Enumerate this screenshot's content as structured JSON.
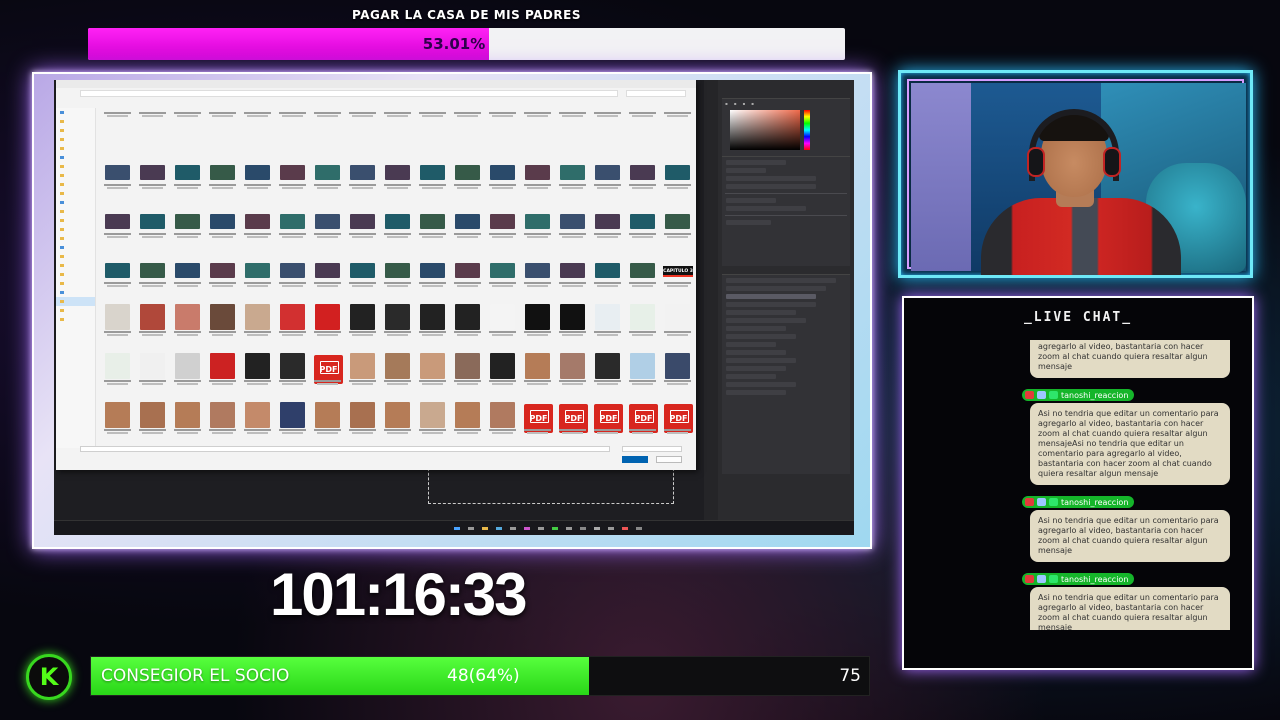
{
  "top_goal": {
    "title": "PAGAR LA CASA DE MIS PADRES",
    "percent_label": "53.01%",
    "progress": 0.5301,
    "fill_color": "#ff22f5"
  },
  "screen_share": {
    "file_dialog": {
      "rows": [
        {
          "kind": "caption-only",
          "items": 17
        },
        {
          "kind": "thumbs",
          "items": 17
        },
        {
          "kind": "thumbs",
          "items": 17
        },
        {
          "kind": "thumbs",
          "items": 17,
          "last_label": "CAPITULO 3"
        },
        {
          "kind": "mixed",
          "items": 17
        },
        {
          "kind": "mixed2",
          "items": 17
        },
        {
          "kind": "faces",
          "items": 12,
          "pdf_count": 5
        }
      ],
      "pdf_label": "PDF",
      "capitulo_label": "CAPITULO 3"
    }
  },
  "timer": {
    "value": "101:16:33"
  },
  "live_chat": {
    "title": "_LIVE CHAT_",
    "messages": [
      {
        "user": "",
        "text": "agregarlo al video, bastantaria con hacer zoom al chat cuando quiera resaltar algun mensaje",
        "truncated_top": true
      },
      {
        "user": "tanoshi_reaccion",
        "text": "Asi no tendria que editar un comentario para agregarlo al video, bastantaria con hacer zoom al chat cuando quiera resaltar algun mensajeAsi no tendria que editar un comentario para agregarlo al video, bastantaria con hacer zoom al chat cuando quiera resaltar algun mensaje"
      },
      {
        "user": "tanoshi_reaccion",
        "text": "Asi no tendria que editar un comentario para agregarlo al video, bastantaria con hacer zoom al chat cuando quiera resaltar algun mensaje"
      },
      {
        "user": "tanoshi_reaccion",
        "text": "Asi no tendria que editar un comentario para agregarlo al video, bastantaria con hacer zoom al chat cuando quiera resaltar algun mensaje"
      },
      {
        "user": "tanoshi_reaccion",
        "text": "Asi no tendria que editar un comentario para agregarlo al video, bastantaria con hacer zoom al chat cuando quiera resaltar algun mensaje"
      }
    ],
    "badge_colors": [
      "#e23b3b",
      "#9cc6ff",
      "#2ee66a"
    ]
  },
  "sub_goal": {
    "title": "CONSEGIOR EL SOCIO",
    "count_label": "48(64%)",
    "target": "75",
    "progress": 0.64,
    "fill_color": "#3ee32a",
    "logo_letter": "K"
  }
}
